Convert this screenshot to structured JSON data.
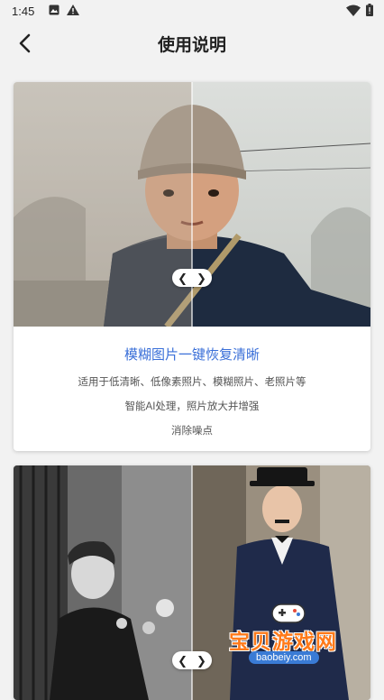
{
  "status_bar": {
    "time": "1:45",
    "left_icons": [
      "image-notification-icon",
      "warning-icon"
    ],
    "right_icons": [
      "wifi-icon",
      "battery-icon"
    ]
  },
  "header": {
    "title": "使用说明",
    "back_icon": "chevron-left-icon"
  },
  "cards": [
    {
      "heading": "模糊图片一键恢复清晰",
      "lines": [
        "适用于低清晰、低像素照片、模糊照片、老照片等",
        "智能AI处理，照片放大并增强",
        "消除噪点"
      ],
      "handle_left": "❮",
      "handle_right": "❯"
    },
    {
      "handle_left": "❮",
      "handle_right": "❯"
    }
  ],
  "watermark": {
    "title": "宝贝游戏网",
    "url": "baobeiy.com"
  },
  "colors": {
    "heading": "#3a6fd8",
    "background": "#f2f2f2",
    "watermark": "#ff7a1a"
  }
}
